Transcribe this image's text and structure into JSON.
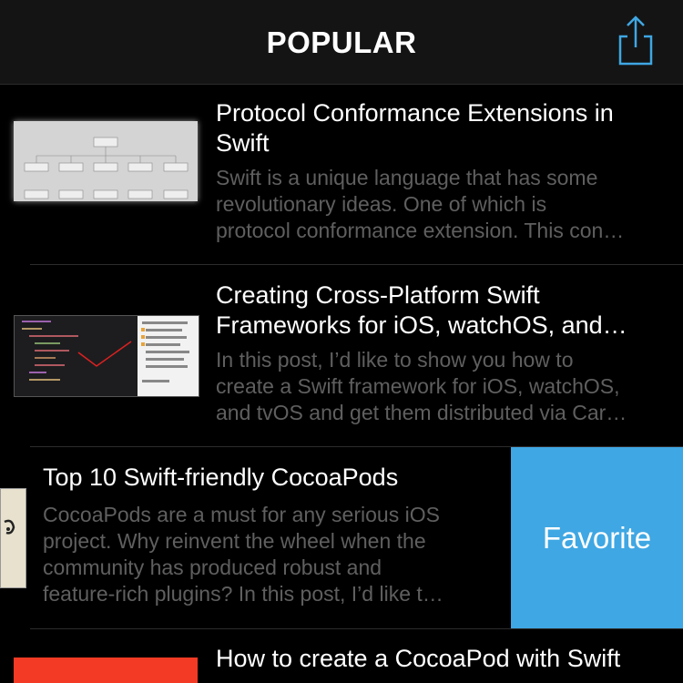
{
  "navbar": {
    "title": "POPULAR",
    "share_icon": "share-icon",
    "accent": "#3fa7e3"
  },
  "articles": [
    {
      "title": "Protocol Conformance Extensions in\nSwift",
      "excerpt": "Swift is a unique language that has some\nrevolutionary ideas. One of which is\nprotocol conformance extension. This con…"
    },
    {
      "title": "Creating Cross-Platform Swift\nFrameworks for iOS, watchOS, and…",
      "excerpt": "In this post, I’d like to show you how to\ncreate a Swift framework for iOS, watchOS,\nand tvOS and get them distributed via Car…"
    },
    {
      "title": "Top 10 Swift-friendly CocoaPods",
      "excerpt": "CocoaPods are a must for any serious iOS\nproject. Why reinvent the wheel when the\ncommunity has produced robust and\nfeature-rich plugins? In this post, I’d like t…"
    },
    {
      "title": "How to create a CocoaPod with Swift"
    }
  ],
  "swipe_action": {
    "label": "Favorite",
    "color": "#3fa7e3"
  }
}
